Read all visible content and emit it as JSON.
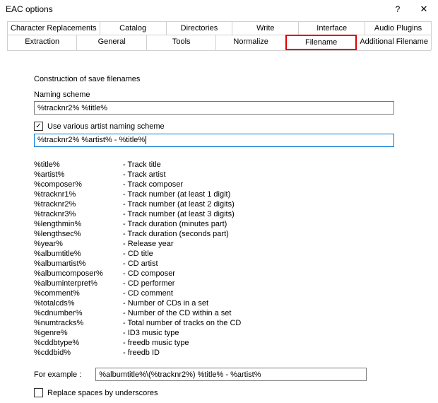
{
  "window": {
    "title": "EAC options",
    "help_symbol": "?",
    "close_symbol": "✕"
  },
  "tabs": {
    "row1": [
      "Character Replacements",
      "Catalog",
      "Directories",
      "Write",
      "Interface",
      "Audio Plugins"
    ],
    "row2": [
      "Extraction",
      "General",
      "Tools",
      "Normalize",
      "Filename",
      "Additional Filename"
    ],
    "selected": "Filename"
  },
  "section": {
    "construction": "Construction of save filenames",
    "naming_label": "Naming scheme",
    "naming_value": "%tracknr2% %title%",
    "va_checkbox_label": "Use various artist naming scheme",
    "va_checked": true,
    "va_value": "%tracknr2% %artist% - %title%",
    "example_label": "For example :",
    "example_value": "%albumtitle%\\(%tracknr2%) %title% - %artist%",
    "replace_label": "Replace spaces by underscores",
    "replace_checked": false
  },
  "tokens": [
    {
      "k": "%title%",
      "v": "Track title"
    },
    {
      "k": "%artist%",
      "v": "Track artist"
    },
    {
      "k": "%composer%",
      "v": "Track composer"
    },
    {
      "k": "%tracknr1%",
      "v": "Track number (at least 1 digit)"
    },
    {
      "k": "%tracknr2%",
      "v": "Track number (at least 2 digits)"
    },
    {
      "k": "%tracknr3%",
      "v": "Track number (at least 3 digits)"
    },
    {
      "k": "%lengthmin%",
      "v": "Track duration (minutes part)"
    },
    {
      "k": "%lengthsec%",
      "v": "Track duration (seconds part)"
    },
    {
      "k": "%year%",
      "v": "Release year"
    },
    {
      "k": "%albumtitle%",
      "v": "CD title"
    },
    {
      "k": "%albumartist%",
      "v": "CD artist"
    },
    {
      "k": "%albumcomposer%",
      "v": "CD composer"
    },
    {
      "k": "%albuminterpret%",
      "v": "CD performer"
    },
    {
      "k": "%comment%",
      "v": "CD comment"
    },
    {
      "k": "%totalcds%",
      "v": "Number of CDs in a set"
    },
    {
      "k": "%cdnumber%",
      "v": "Number of the CD within a set"
    },
    {
      "k": "%numtracks%",
      "v": "Total number of tracks on the CD"
    },
    {
      "k": "%genre%",
      "v": "ID3 music type"
    },
    {
      "k": "%cddbtype%",
      "v": "freedb music type"
    },
    {
      "k": "%cddbid%",
      "v": "freedb ID"
    }
  ]
}
